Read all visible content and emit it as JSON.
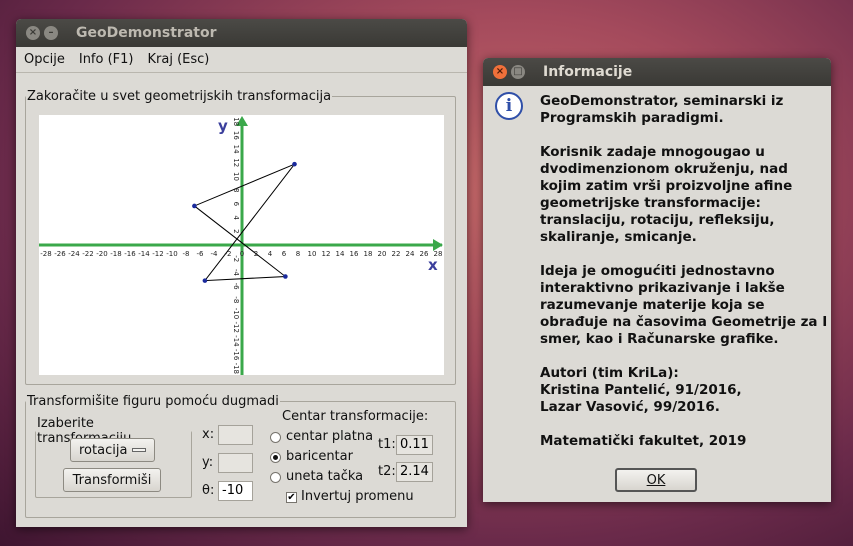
{
  "main_window": {
    "title": "GeoDemonstrator",
    "menu": [
      "Opcije",
      "Info (F1)",
      "Kraj (Esc)"
    ],
    "canvas_group": "Zakoračite u svet geometrijskih transformacija",
    "transform_group": "Transformišite figuru pomoću dugmadi",
    "choose_group": "Izaberite transformaciju",
    "transformation_select": "rotacija",
    "transform_button": "Transformiši",
    "x_label": "x:",
    "y_label": "y:",
    "theta_label": "θ:",
    "x_value": "",
    "y_value": "",
    "theta_value": "-10",
    "center_title": "Centar transformacije:",
    "center_options": [
      "centar platna",
      "baricentar",
      "uneta tačka"
    ],
    "center_selected": 1,
    "t1_label": "t1:",
    "t1_value": "0.11",
    "t2_label": "t2:",
    "t2_value": "2.14",
    "invert_label": "Invertuj promenu",
    "invert_checked": true
  },
  "plot": {
    "x_axis_label": "x",
    "y_axis_label": "y",
    "x_ticks": [
      -28,
      -26,
      -24,
      -22,
      -20,
      -18,
      -16,
      -14,
      -12,
      -10,
      -8,
      -6,
      -4,
      -2,
      0,
      2,
      4,
      6,
      8,
      10,
      12,
      14,
      16,
      18,
      20,
      22,
      24,
      26,
      28
    ],
    "y_ticks": [
      18,
      16,
      14,
      12,
      10,
      8,
      6,
      4,
      2,
      -2,
      -4,
      -6,
      -8,
      -10,
      -12,
      -14,
      -16,
      -18
    ],
    "polygon": [
      [
        7.5,
        11.8
      ],
      [
        -6.8,
        5.7
      ],
      [
        6.2,
        -4.6
      ],
      [
        -5.3,
        -5.2
      ]
    ],
    "axis_color": "#3aa84a",
    "label_color": "#3b3f9c",
    "polygon_color": "#000000",
    "vertex_color": "#1a2a9c"
  },
  "info_window": {
    "title": "Informacije",
    "paragraphs": [
      "GeoDemonstrator, seminarski iz Programskih paradigmi.",
      "Korisnik zadaje mnogougao u dvodimenzionom okruženju, nad kojim zatim vrši proizvoljne afine geometrijske transformacije: translaciju, rotaciju, refleksiju, skaliranje, smicanje.",
      "Ideja je omogućiti jednostavno interaktivno prikazivanje i lakše razumevanje materije koja se obrađuje na časovima Geometrije za I smer, kao i Računarske grafike.",
      "Autori (tim KriLa):\nKristina Pantelić, 91/2016,\nLazar Vasović, 99/2016.",
      "Matematički fakultet, 2019"
    ],
    "ok_button": "OK"
  }
}
